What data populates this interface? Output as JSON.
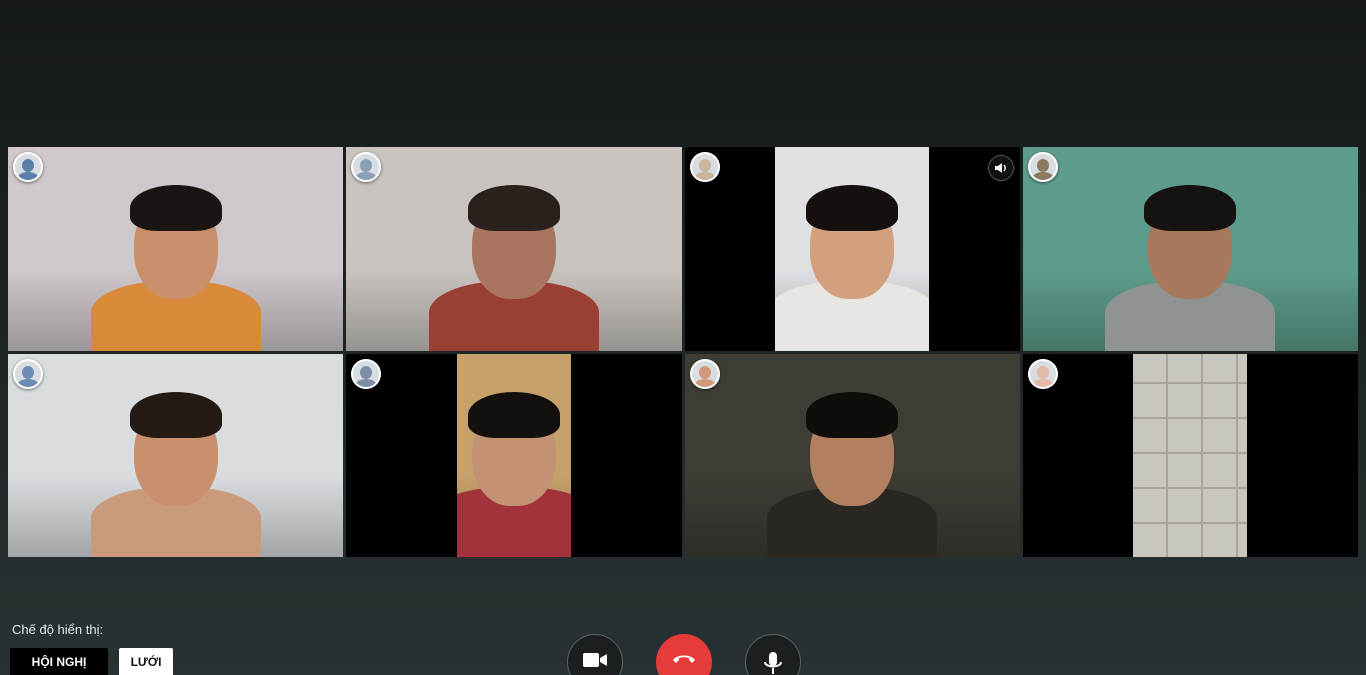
{
  "participants": [
    {
      "id": "p1",
      "layout": "full",
      "bg": "#cfc8cc",
      "skin": "#c98f6a",
      "hair": "#1a1512",
      "shirt": "#d88a3a",
      "avatar_color": "#5b7fa8"
    },
    {
      "id": "p2",
      "layout": "full",
      "bg": "#c9c4c0",
      "skin": "#a87560",
      "hair": "#2a211c",
      "shirt": "#9a3f33",
      "avatar_color": "#8aa0b8"
    },
    {
      "id": "p3",
      "layout": "narrow",
      "bg": "#dfe0e4",
      "skin": "#d2a07e",
      "hair": "#15100d",
      "shirt": "#e8e6e3",
      "avatar_color": "#c9b49d",
      "speaking": true
    },
    {
      "id": "p4",
      "layout": "full",
      "bg": "#5d9c8c",
      "skin": "#a8785c",
      "hair": "#161210",
      "shirt": "#8f9392",
      "avatar_color": "#8c7a60"
    },
    {
      "id": "p5",
      "layout": "full",
      "bg": "#d9dde0",
      "skin": "#c98e6c",
      "hair": "#241a14",
      "shirt": "#c99b7c",
      "avatar_color": "#6d8cb5"
    },
    {
      "id": "p6",
      "layout": "mid",
      "bg": "#c7a06a",
      "skin": "#c39274",
      "hair": "#14100e",
      "shirt": "#a3333b",
      "avatar_color": "#7c8fa6"
    },
    {
      "id": "p7",
      "layout": "full",
      "bg": "#3f3c36",
      "skin": "#b08060",
      "hair": "#0f0c0a",
      "shirt": "#2a2622",
      "avatar_color": "#d09a7a"
    },
    {
      "id": "p8",
      "layout": "mid",
      "bg": "#c9c6bf",
      "skin": "#c9c6bf",
      "hair": "#c9c6bf",
      "shirt": "#9ea2a0",
      "avatar_color": "#e3b8a6",
      "ceiling": true
    }
  ],
  "display_mode": {
    "label": "Chế độ hiển thị:",
    "options": [
      "HỘI NGHỊ",
      "LƯỚI"
    ],
    "selected": "HỘI NGHỊ"
  },
  "controls": {
    "camera_icon": "video-camera-icon",
    "hangup_icon": "phone-hangup-icon",
    "mic_icon": "microphone-icon",
    "hangup_color": "#e53b3b"
  }
}
